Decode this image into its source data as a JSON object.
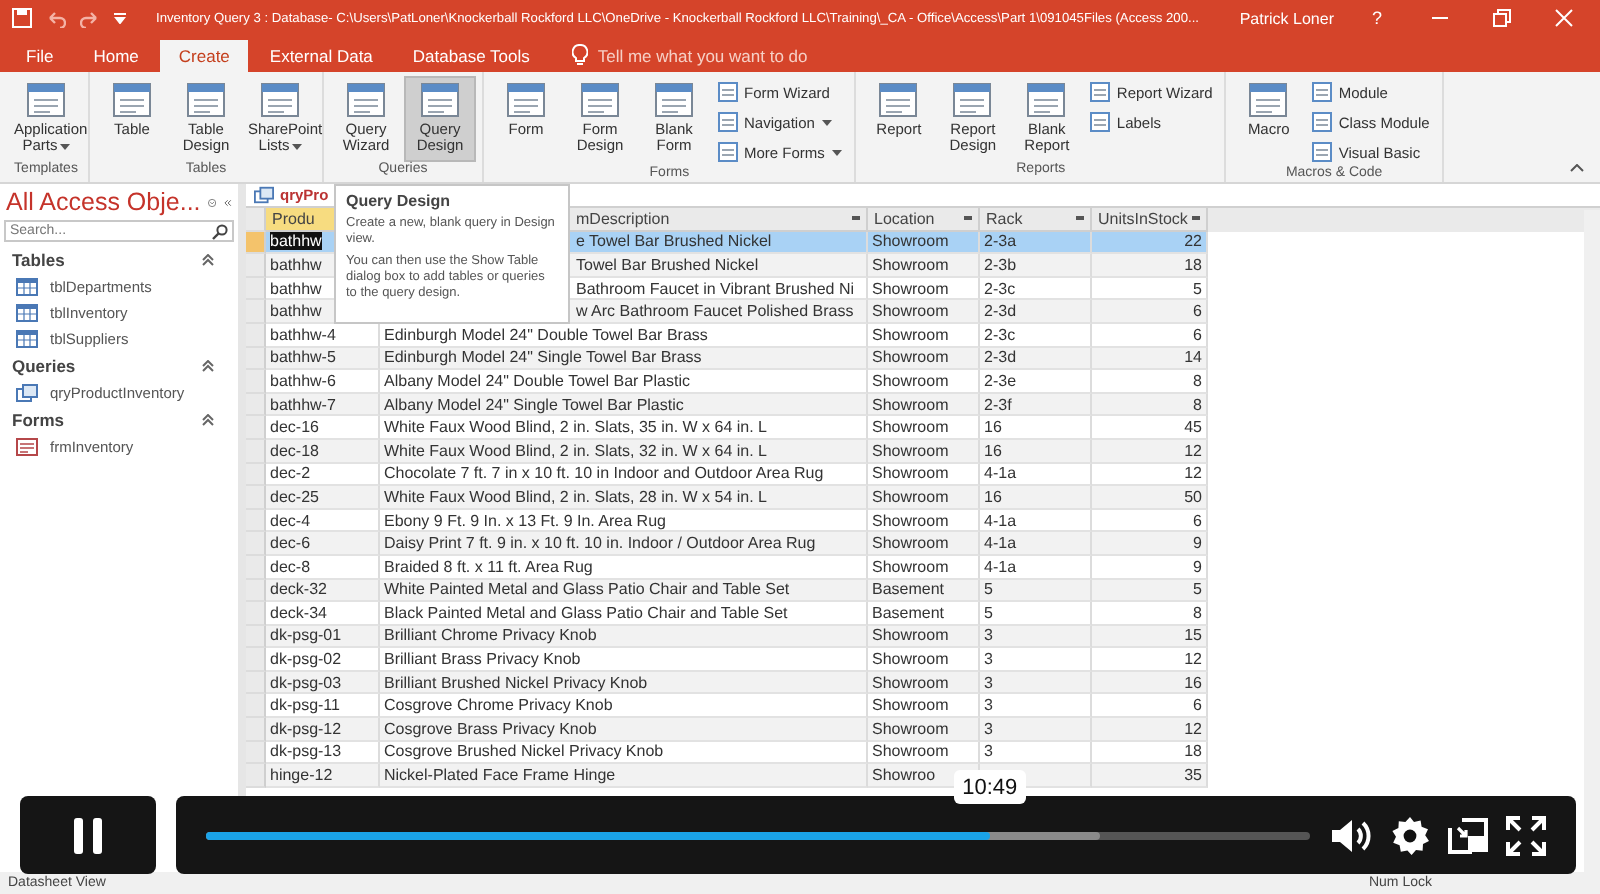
{
  "title_bar": {
    "title": "Inventory Query 3 : Database- C:\\Users\\PatLoner\\Knockerball Rockford LLC\\OneDrive - Knockerball Rockford LLC\\Training\\_CA - Office\\Access\\Part 1\\091045Files (Access 200...",
    "user": "Patrick Loner",
    "help": "?"
  },
  "ribbon_tabs": [
    {
      "label": "File",
      "selected": false
    },
    {
      "label": "Home",
      "selected": false
    },
    {
      "label": "Create",
      "selected": true
    },
    {
      "label": "External Data",
      "selected": false
    },
    {
      "label": "Database Tools",
      "selected": false
    }
  ],
  "tell_me": "Tell me what you want to do",
  "ribbon_groups": [
    {
      "name": "Templates",
      "buttons": [
        {
          "label": "Application Parts",
          "kind": "large",
          "dropdown": true,
          "selected": false
        }
      ]
    },
    {
      "name": "Tables",
      "buttons": [
        {
          "label": "Table",
          "kind": "large",
          "dropdown": false,
          "selected": false
        },
        {
          "label": "Table Design",
          "kind": "large",
          "dropdown": false,
          "selected": false
        },
        {
          "label": "SharePoint Lists",
          "kind": "large",
          "dropdown": true,
          "selected": false
        }
      ]
    },
    {
      "name": "Queries",
      "buttons": [
        {
          "label": "Query Wizard",
          "kind": "large",
          "dropdown": false,
          "selected": false
        },
        {
          "label": "Query Design",
          "kind": "large",
          "dropdown": false,
          "selected": true
        }
      ]
    },
    {
      "name": "Forms",
      "buttons": [
        {
          "label": "Form",
          "kind": "large",
          "dropdown": false,
          "selected": false
        },
        {
          "label": "Form Design",
          "kind": "large",
          "dropdown": false,
          "selected": false
        },
        {
          "label": "Blank Form",
          "kind": "large",
          "dropdown": false,
          "selected": false
        },
        {
          "label": "Form Wizard",
          "kind": "small",
          "dropdown": false,
          "selected": false
        },
        {
          "label": "Navigation",
          "kind": "small",
          "dropdown": true,
          "selected": false
        },
        {
          "label": "More Forms",
          "kind": "small",
          "dropdown": true,
          "selected": false
        }
      ]
    },
    {
      "name": "Reports",
      "buttons": [
        {
          "label": "Report",
          "kind": "large",
          "dropdown": false,
          "selected": false
        },
        {
          "label": "Report Design",
          "kind": "large",
          "dropdown": false,
          "selected": false
        },
        {
          "label": "Blank Report",
          "kind": "large",
          "dropdown": false,
          "selected": false
        },
        {
          "label": "Report Wizard",
          "kind": "small",
          "dropdown": false,
          "selected": false
        },
        {
          "label": "Labels",
          "kind": "small",
          "dropdown": false,
          "selected": false
        }
      ]
    },
    {
      "name": "Macros & Code",
      "buttons": [
        {
          "label": "Macro",
          "kind": "large",
          "dropdown": false,
          "selected": false
        },
        {
          "label": "Module",
          "kind": "small",
          "dropdown": false,
          "selected": false
        },
        {
          "label": "Class Module",
          "kind": "small",
          "dropdown": false,
          "selected": false
        },
        {
          "label": "Visual Basic",
          "kind": "small",
          "dropdown": false,
          "selected": false
        }
      ]
    }
  ],
  "nav_pane": {
    "title": "All Access Obje...",
    "search_placeholder": "Search...",
    "groups": [
      {
        "label": "Tables",
        "expanded": true,
        "children": [
          {
            "label": "tblDepartments",
            "kind": "table"
          },
          {
            "label": "tblInventory",
            "kind": "table"
          },
          {
            "label": "tblSuppliers",
            "kind": "table"
          }
        ]
      },
      {
        "label": "Queries",
        "expanded": true,
        "children": [
          {
            "label": "qryProductInventory",
            "kind": "query"
          }
        ]
      },
      {
        "label": "Forms",
        "expanded": true,
        "children": [
          {
            "label": "frmInventory",
            "kind": "form"
          }
        ]
      }
    ]
  },
  "datasheet": {
    "tab": "qryPro",
    "columns": [
      {
        "label": "Produ",
        "current": true,
        "filter": false
      },
      {
        "label": "mDescription",
        "current": false,
        "filter": true
      },
      {
        "label": "Location",
        "current": false,
        "filter": true
      },
      {
        "label": "Rack",
        "current": false,
        "filter": true
      },
      {
        "label": "UnitsInStock",
        "current": false,
        "filter": true
      }
    ],
    "rows": [
      {
        "selected": true,
        "cells": [
          "bathhw",
          "e Towel Bar Brushed Nickel",
          "Showroom",
          "2-3a",
          "22"
        ]
      },
      {
        "selected": false,
        "cells": [
          "bathhw",
          "Towel Bar Brushed Nickel",
          "Showroom",
          "2-3b",
          "18"
        ]
      },
      {
        "selected": false,
        "cells": [
          "bathhw",
          "Bathroom Faucet in Vibrant Brushed Ni",
          "Showroom",
          "2-3c",
          "5"
        ]
      },
      {
        "selected": false,
        "cells": [
          "bathhw",
          "w Arc Bathroom Faucet Polished Brass",
          "Showroom",
          "2-3d",
          "6"
        ]
      },
      {
        "selected": false,
        "cells": [
          "bathhw-4",
          "Edinburgh Model 24\" Double Towel Bar Brass",
          "Showroom",
          "2-3c",
          "6"
        ]
      },
      {
        "selected": false,
        "cells": [
          "bathhw-5",
          "Edinburgh Model 24\" Single Towel Bar Brass",
          "Showroom",
          "2-3d",
          "14"
        ]
      },
      {
        "selected": false,
        "cells": [
          "bathhw-6",
          "Albany Model 24\" Double Towel Bar Plastic",
          "Showroom",
          "2-3e",
          "8"
        ]
      },
      {
        "selected": false,
        "cells": [
          "bathhw-7",
          "Albany Model 24\" Single Towel Bar Plastic",
          "Showroom",
          "2-3f",
          "8"
        ]
      },
      {
        "selected": false,
        "cells": [
          "dec-16",
          "White Faux Wood Blind, 2 in. Slats, 35 in. W x 64 in. L",
          "Showroom",
          "16",
          "45"
        ]
      },
      {
        "selected": false,
        "cells": [
          "dec-18",
          "White Faux Wood Blind, 2 in. Slats, 32 in. W x 64 in. L",
          "Showroom",
          "16",
          "12"
        ]
      },
      {
        "selected": false,
        "cells": [
          "dec-2",
          "Chocolate 7 ft. 7 in x 10 ft. 10 in Indoor and Outdoor Area Rug",
          "Showroom",
          "4-1a",
          "12"
        ]
      },
      {
        "selected": false,
        "cells": [
          "dec-25",
          "White Faux Wood Blind, 2 in. Slats, 28 in. W x 54 in. L",
          "Showroom",
          "16",
          "50"
        ]
      },
      {
        "selected": false,
        "cells": [
          "dec-4",
          "Ebony 9 Ft. 9 In. x 13 Ft. 9 In. Area Rug",
          "Showroom",
          "4-1a",
          "6"
        ]
      },
      {
        "selected": false,
        "cells": [
          "dec-6",
          "Daisy Print 7 ft. 9 in. x 10 ft. 10 in. Indoor / Outdoor Area Rug",
          "Showroom",
          "4-1a",
          "9"
        ]
      },
      {
        "selected": false,
        "cells": [
          "dec-8",
          "Braided 8 ft. x 11 ft. Area Rug",
          "Showroom",
          "4-1a",
          "9"
        ]
      },
      {
        "selected": false,
        "cells": [
          "deck-32",
          "White Painted Metal and Glass Patio Chair and Table Set",
          "Basement",
          "5",
          "5"
        ]
      },
      {
        "selected": false,
        "cells": [
          "deck-34",
          "Black Painted Metal and Glass Patio Chair and Table Set",
          "Basement",
          "5",
          "8"
        ]
      },
      {
        "selected": false,
        "cells": [
          "dk-psg-01",
          "Brilliant Chrome Privacy Knob",
          "Showroom",
          "3",
          "15"
        ]
      },
      {
        "selected": false,
        "cells": [
          "dk-psg-02",
          "Brilliant Brass Privacy Knob",
          "Showroom",
          "3",
          "12"
        ]
      },
      {
        "selected": false,
        "cells": [
          "dk-psg-03",
          "Brilliant Brushed Nickel Privacy Knob",
          "Showroom",
          "3",
          "16"
        ]
      },
      {
        "selected": false,
        "cells": [
          "dk-psg-11",
          "Cosgrove Chrome Privacy Knob",
          "Showroom",
          "3",
          "6"
        ]
      },
      {
        "selected": false,
        "cells": [
          "dk-psg-12",
          "Cosgrove Brass Privacy Knob",
          "Showroom",
          "3",
          "12"
        ]
      },
      {
        "selected": false,
        "cells": [
          "dk-psg-13",
          "Cosgrove Brushed Nickel Privacy Knob",
          "Showroom",
          "3",
          "18"
        ]
      },
      {
        "selected": false,
        "cells": [
          "hinge-12",
          "Nickel-Plated Face Frame Hinge",
          "Showroo",
          null,
          "35"
        ]
      }
    ]
  },
  "tooltip": {
    "title": "Query Design",
    "text": "Create a new, blank query in Design view.",
    "text_2": "You can then use the Show Table dialog box to add tables or queries to the query design."
  },
  "player": {
    "playing": true,
    "level": 0.71,
    "buffer": {
      "level": 0.81
    },
    "time": "10:49"
  },
  "status_bar": {
    "left": "Datasheet View",
    "right": "Num Lock"
  }
}
